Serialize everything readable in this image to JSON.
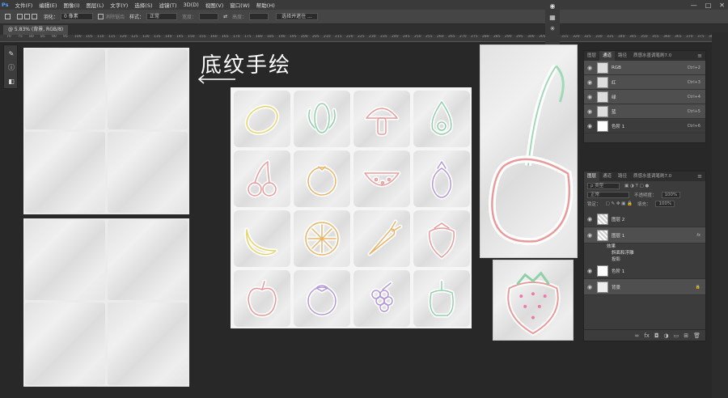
{
  "menu": [
    "文件(F)",
    "编辑(E)",
    "图像(I)",
    "图层(L)",
    "文字(Y)",
    "选择(S)",
    "滤镜(T)",
    "3D(D)",
    "视图(V)",
    "窗口(W)",
    "帮助(H)"
  ],
  "window_controls": [
    "—",
    "□",
    "✕"
  ],
  "options": {
    "feather_label": "羽化：",
    "feather_value": "0 像素",
    "antialias_label": "消除锯齿",
    "style_label": "样式：",
    "style_value": "正常",
    "width_label": "宽度：",
    "height_label": "高度：",
    "select_mask_button": "选择并遮住 ..."
  },
  "doc_tab": "@ 5.83% (背景, RGB/8)",
  "ruler_ticks": [
    "70",
    "75",
    "80",
    "85",
    "90",
    "95",
    "100",
    "105",
    "110",
    "115",
    "120",
    "125",
    "130",
    "135",
    "140",
    "145",
    "150",
    "155",
    "160",
    "165",
    "170",
    "175",
    "180",
    "185",
    "190",
    "195",
    "200",
    "205",
    "210",
    "215",
    "220",
    "225",
    "230",
    "235",
    "240",
    "245",
    "250",
    "255",
    "260",
    "265",
    "270",
    "275",
    "280",
    "285",
    "290",
    "295",
    "300",
    "305",
    "310",
    "315",
    "320",
    "325",
    "330",
    "335",
    "340",
    "345",
    "350",
    "355",
    "360",
    "365",
    "370",
    "375",
    "380"
  ],
  "tools": [
    "brush-icon",
    "info-icon",
    "adjust-icon"
  ],
  "side_icons": [
    "swirl-icon",
    "grid-icon",
    "snowflake-icon"
  ],
  "canvas": {
    "title": "底纹手绘",
    "icons": [
      "lemon",
      "corn",
      "mushroom",
      "avocado",
      "cherries",
      "orange",
      "watermelon",
      "eggplant",
      "banana",
      "citrus-slice",
      "carrot",
      "strawberry",
      "apple",
      "mangosteen",
      "grapes",
      "bell-pepper"
    ]
  },
  "channels_panel": {
    "tabs": [
      "图层",
      "通道",
      "路径",
      "质感水墨调笔刷7.0"
    ],
    "active_tab": 1,
    "rows": [
      {
        "name": "RGB",
        "shortcut": "Ctrl+2"
      },
      {
        "name": "红",
        "shortcut": "Ctrl+3"
      },
      {
        "name": "绿",
        "shortcut": "Ctrl+4"
      },
      {
        "name": "蓝",
        "shortcut": "Ctrl+5"
      },
      {
        "name": "色阶 1",
        "shortcut": "Ctrl+6"
      }
    ]
  },
  "layers_panel": {
    "tabs": [
      "图层",
      "通道",
      "路径",
      "质感水墨调笔刷7.0"
    ],
    "active_tab": 0,
    "kind_filter": "ρ 类型",
    "blend_mode": "正常",
    "opacity_label": "不透明度：",
    "opacity_value": "100%",
    "lock_label": "锁定：",
    "fill_label": "填充：",
    "fill_value": "100%",
    "layers": [
      {
        "name": "图层 2",
        "fx": ""
      },
      {
        "name": "图层 1",
        "fx": "fx"
      },
      {
        "name": "色阶 1",
        "fx": ""
      },
      {
        "name": "背景",
        "fx": ""
      }
    ],
    "effects_label": "效果",
    "effects": [
      "斜面和浮雕",
      "投影"
    ],
    "bottom_icons": [
      "link-icon",
      "fx-icon",
      "mask-icon",
      "adjustment-icon",
      "folder-icon",
      "new-layer-icon",
      "trash-icon"
    ]
  },
  "colors": {
    "accent_red": "#e85a5a",
    "accent_green": "#6cc49a",
    "accent_yellow": "#e8d36a",
    "accent_purple": "#b598d8"
  }
}
